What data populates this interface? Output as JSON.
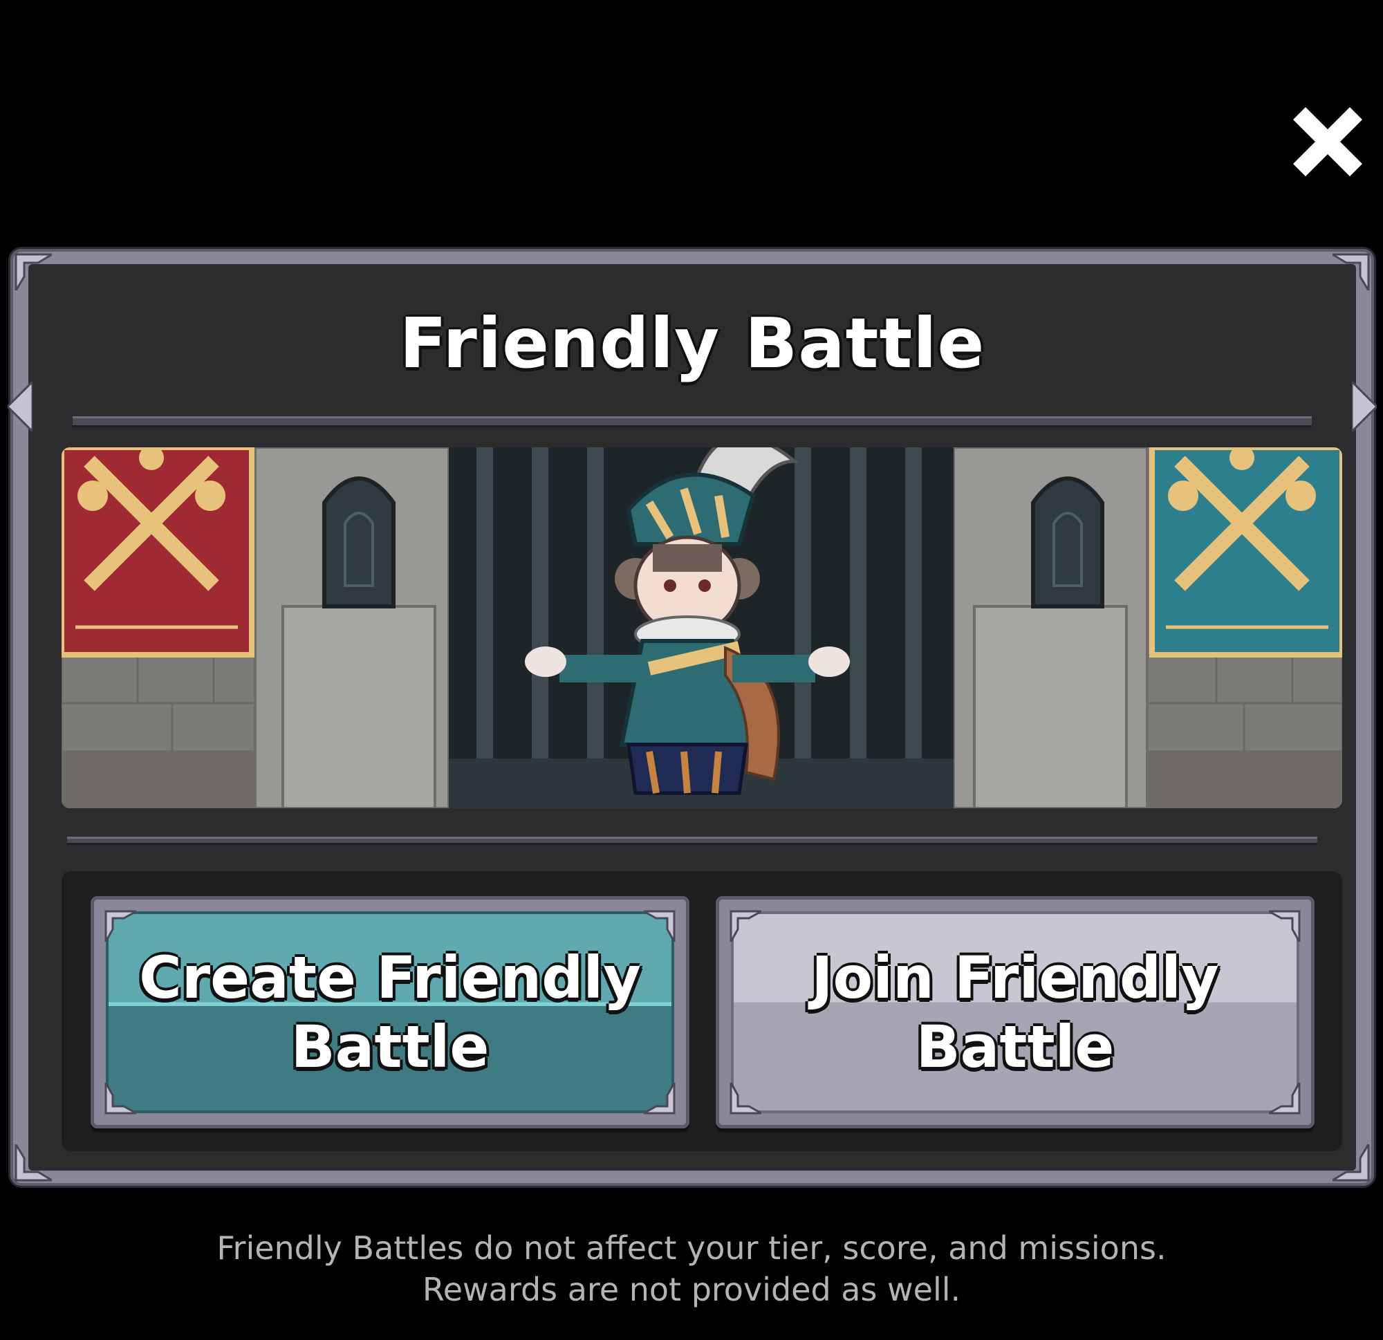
{
  "dialog": {
    "title": "Friendly Battle",
    "create_button_label": "Create Friendly Battle",
    "join_button_label": "Join Friendly Battle",
    "footer_line1": "Friendly Battles do not affect your tier, score, and missions.",
    "footer_line2": "Rewards are not provided as well."
  },
  "icons": {
    "close": "close-icon",
    "left_banner": "red-crossed-swords-skull-banner",
    "right_banner": "teal-crossed-swords-skull-banner",
    "character": "feathered-hat-musketeer"
  },
  "colors": {
    "background": "#000000",
    "panel_frame": "#8a8898",
    "panel_fill": "#2c2c2e",
    "create_button": "#4f8f97",
    "join_button": "#b8b6c4",
    "red_banner": "#a02a34",
    "teal_banner": "#2e7f8e",
    "gold": "#e7c27a"
  }
}
